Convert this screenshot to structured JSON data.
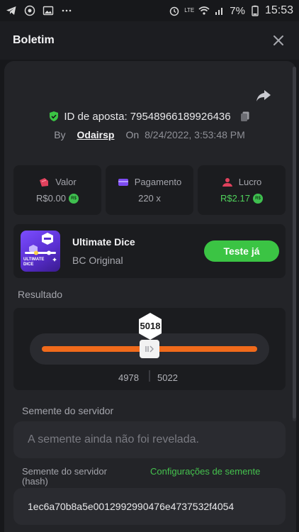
{
  "status_bar": {
    "time": "15:53",
    "battery_pct": "7%",
    "network": "LTE"
  },
  "header": {
    "title": "Boletim"
  },
  "bet": {
    "id_text": "ID de aposta: 79548966189926436",
    "by_label": "By",
    "user": "Odairsp",
    "on_label": "On",
    "date": "8/24/2022, 3:53:48 PM"
  },
  "stats": [
    {
      "label": "Valor",
      "value": "R$0.00",
      "coin": "R$",
      "icon": "bet-amount-icon"
    },
    {
      "label": "Pagamento",
      "value": "220 x",
      "icon": "payout-icon"
    },
    {
      "label": "Lucro",
      "value": "R$2.17",
      "coin": "R$",
      "icon": "profit-icon"
    }
  ],
  "game": {
    "name": "Ultimate Dice",
    "subtitle": "BC Original",
    "thumb_text_1": "ULTIMATE",
    "thumb_text_2": "DICE",
    "try_label": "Teste já"
  },
  "result": {
    "label": "Resultado",
    "value": "5018",
    "range_low": "4978",
    "range_high": "5022",
    "slider_min": 0,
    "slider_max": 10000
  },
  "seed": {
    "label": "Semente do servidor",
    "placeholder": "A semente ainda não foi revelada.",
    "hash_label": "Semente do servidor (hash)",
    "config_link": "Configurações de semente",
    "hash_value": "1ec6a70b8a5e0012992990476e4737532f4054"
  },
  "colors": {
    "background": "#17181b",
    "card": "#232428",
    "accent_green": "#3bc444",
    "slider_orange": "#f06a1b",
    "shield_green": "#3bc444",
    "game_purple": "#6a3ff0"
  }
}
